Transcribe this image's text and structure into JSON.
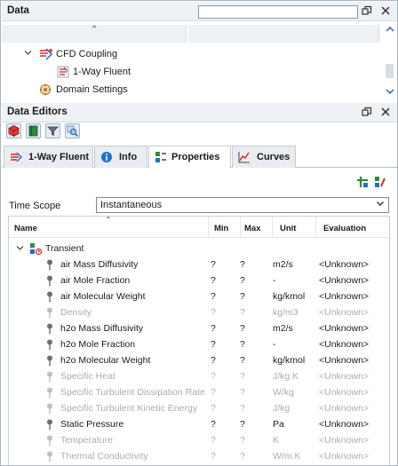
{
  "data_panel": {
    "title": "Data",
    "search_value": "",
    "tree": [
      {
        "label": "CFD Coupling",
        "level": 1,
        "expanded": true
      },
      {
        "label": "1-Way Fluent",
        "level": 2
      },
      {
        "label": "Domain Settings",
        "level": 1
      }
    ]
  },
  "editors_panel": {
    "title": "Data Editors",
    "tabs": [
      {
        "label": "1-Way Fluent",
        "active": false
      },
      {
        "label": "Info",
        "active": false
      },
      {
        "label": "Properties",
        "active": true
      },
      {
        "label": "Curves",
        "active": false
      }
    ],
    "time_scope_label": "Time Scope",
    "time_scope_value": "Instantaneous",
    "columns": [
      "Name",
      "Min",
      "Max",
      "Unit",
      "Evaluation"
    ],
    "group": "Transient",
    "rows": [
      {
        "name": "air Mass Diffusivity",
        "min": "?",
        "max": "?",
        "unit": "m2/s",
        "eval": "<Unknown>",
        "enabled": true
      },
      {
        "name": "air Mole Fraction",
        "min": "?",
        "max": "?",
        "unit": "-",
        "eval": "<Unknown>",
        "enabled": true
      },
      {
        "name": "air Molecular Weight",
        "min": "?",
        "max": "?",
        "unit": "kg/kmol",
        "eval": "<Unknown>",
        "enabled": true
      },
      {
        "name": "Density",
        "min": "?",
        "max": "?",
        "unit": "kg/m3",
        "eval": "<Unknown>",
        "enabled": false
      },
      {
        "name": "h2o Mass Diffusivity",
        "min": "?",
        "max": "?",
        "unit": "m2/s",
        "eval": "<Unknown>",
        "enabled": true
      },
      {
        "name": "h2o Mole Fraction",
        "min": "?",
        "max": "?",
        "unit": "-",
        "eval": "<Unknown>",
        "enabled": true
      },
      {
        "name": "h2o Molecular Weight",
        "min": "?",
        "max": "?",
        "unit": "kg/kmol",
        "eval": "<Unknown>",
        "enabled": true
      },
      {
        "name": "Specific Heat",
        "min": "?",
        "max": "?",
        "unit": "J/kg.K",
        "eval": "<Unknown>",
        "enabled": false
      },
      {
        "name": "Specific Turbulent Dissipation Rate",
        "min": "?",
        "max": "?",
        "unit": "W/kg",
        "eval": "<Unknown>",
        "enabled": false
      },
      {
        "name": "Specific Turbulent Kinetic Energy",
        "min": "?",
        "max": "?",
        "unit": "J/kg",
        "eval": "<Unknown>",
        "enabled": false
      },
      {
        "name": "Static Pressure",
        "min": "?",
        "max": "?",
        "unit": "Pa",
        "eval": "<Unknown>",
        "enabled": true
      },
      {
        "name": "Temperature",
        "min": "?",
        "max": "?",
        "unit": "K",
        "eval": "<Unknown>",
        "enabled": false
      },
      {
        "name": "Thermal Conductivity",
        "min": "?",
        "max": "?",
        "unit": "W/m.K",
        "eval": "<Unknown>",
        "enabled": false
      }
    ]
  },
  "icons": {
    "restore": "restore-icon",
    "close": "close-icon",
    "pin": "pin-icon",
    "add": "add-property-icon"
  },
  "colors": {
    "header_bg": "#eef2f7",
    "accent": "#1e5fb4",
    "disabled_text": "#a7adb5"
  }
}
